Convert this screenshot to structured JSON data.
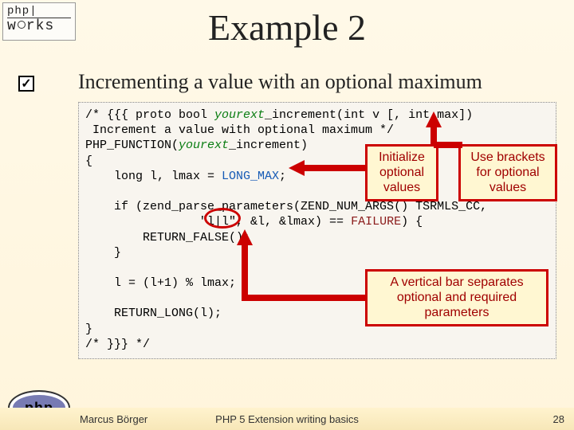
{
  "logo": {
    "line1": "php|",
    "line2_pre": "w",
    "line2_post": "rks"
  },
  "title": "Example 2",
  "checkmark": "✓",
  "subtitle": "Incrementing a value with an optional maximum",
  "code": {
    "c1a": "/* {{{ proto bool ",
    "c1b": "yourext",
    "c1c": "_increment(int v [, int max])",
    "c2": " Increment a value with optional maximum */",
    "c3a": "PHP_FUNCTION(",
    "c3b": "yourext",
    "c3c": "_increment)",
    "c4": "{",
    "c5a": "    long l, lmax = ",
    "c5b": "LONG_MAX",
    "c5c": ";",
    "c6": "",
    "c7": "    if (zend_parse_parameters(ZEND_NUM_ARGS() TSRMLS_CC,",
    "c8a": "                \"l|l\", &l, &lmax) == ",
    "c8b": "FAILURE",
    "c8c": ") {",
    "c9": "        RETURN_FALSE();",
    "c10": "    }",
    "c11": "",
    "c12": "    l = (l+1) % lmax;",
    "c13": "",
    "c14": "    RETURN_LONG(l);",
    "c15": "}",
    "c16": "/* }}} */"
  },
  "callouts": {
    "init": "Initialize\noptional\nvalues",
    "brack": "Use brackets\nfor optional\nvalues",
    "vbar": "A vertical bar separates\noptional and required\nparameters"
  },
  "footer": {
    "author": "Marcus Börger",
    "mid": "PHP 5 Extension writing basics",
    "page": "28"
  },
  "phplogo": "php"
}
